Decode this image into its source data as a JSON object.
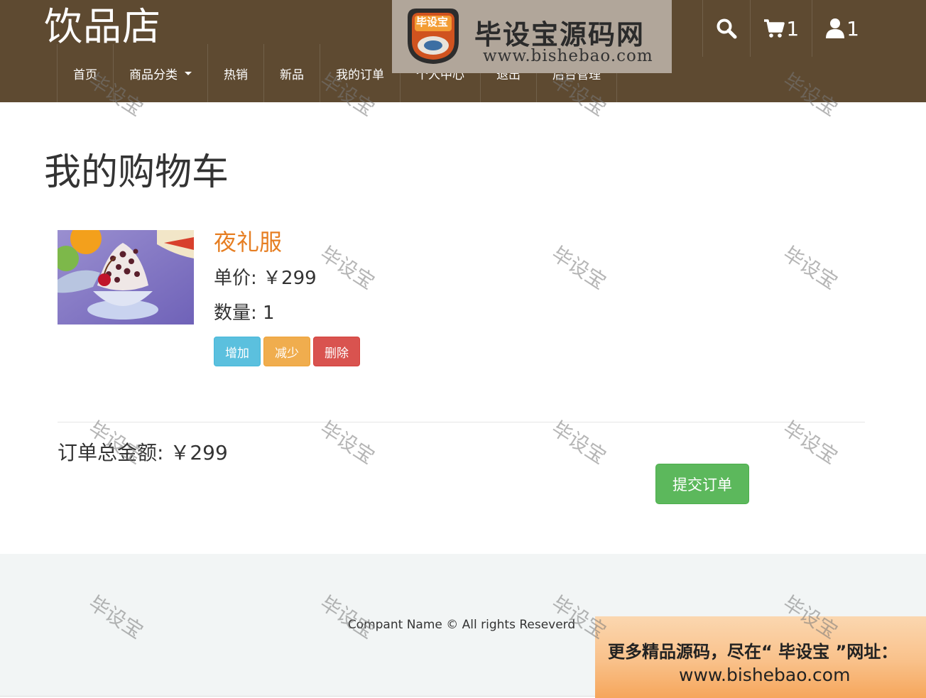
{
  "header": {
    "brand": "饮品店",
    "nav": [
      {
        "label": "首页"
      },
      {
        "label": "商品分类"
      },
      {
        "label": "热销"
      },
      {
        "label": "新品"
      },
      {
        "label": "我的订单"
      },
      {
        "label": "个人中心"
      },
      {
        "label": "退出"
      },
      {
        "label": "后台管理"
      }
    ],
    "cart_count": "1",
    "user_count": "1",
    "icons": {
      "search": "search-icon",
      "cart": "cart-icon",
      "user": "user-icon"
    }
  },
  "logo": {
    "badge": "毕设宝",
    "title": "毕设宝源码网",
    "url": "www.bishebao.com"
  },
  "main": {
    "title": "我的购物车",
    "item": {
      "name": "夜礼服",
      "price_label": "单价: ￥299",
      "qty_label": "数量: 1",
      "buttons": {
        "add": "增加",
        "reduce": "减少",
        "delete": "删除"
      }
    },
    "total_label": "订单总金额: ￥299",
    "submit_label": "提交订单"
  },
  "footer": {
    "text": "Compant Name © All rights Reseverd"
  },
  "promo": {
    "line1": "更多精品源码，尽在“ 毕设宝 ”网址：",
    "line2": "www.bishebao.com"
  },
  "watermark": "毕设宝",
  "colors": {
    "header_bg": "#5e4a31",
    "product_name": "#e67e22",
    "btn_info": "#5bc0de",
    "btn_warning": "#f0ad4e",
    "btn_danger": "#d9534f",
    "btn_success": "#5cb85c"
  }
}
